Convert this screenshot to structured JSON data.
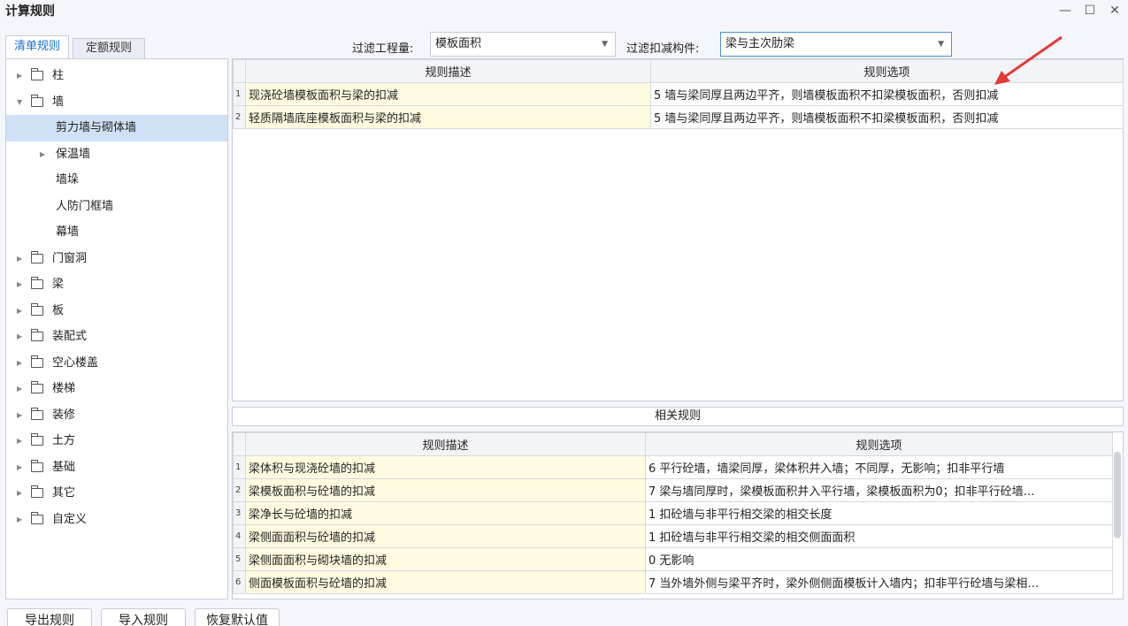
{
  "window": {
    "title": "计算规则",
    "min_glyph": "—",
    "max_glyph": "☐",
    "close_glyph": "✕"
  },
  "tabs": [
    {
      "label": "清单规则",
      "active": true
    },
    {
      "label": "定额规则",
      "active": false
    }
  ],
  "filters": {
    "quantity_label": "过滤工程量:",
    "quantity_value": "模板面积",
    "component_label": "过滤扣减构件:",
    "component_value": "梁与主次肋梁"
  },
  "tree": [
    {
      "label": "柱",
      "level": 0,
      "folder": true,
      "expanded": false
    },
    {
      "label": "墙",
      "level": 0,
      "folder": true,
      "expanded": true
    },
    {
      "label": "剪力墙与砌体墙",
      "level": 1,
      "folder": false,
      "selected": true
    },
    {
      "label": "保温墙",
      "level": 1,
      "folder": false,
      "has_children": true
    },
    {
      "label": "墙垛",
      "level": 1,
      "folder": false
    },
    {
      "label": "人防门框墙",
      "level": 1,
      "folder": false
    },
    {
      "label": "幕墙",
      "level": 1,
      "folder": false
    },
    {
      "label": "门窗洞",
      "level": 0,
      "folder": true
    },
    {
      "label": "梁",
      "level": 0,
      "folder": true
    },
    {
      "label": "板",
      "level": 0,
      "folder": true
    },
    {
      "label": "装配式",
      "level": 0,
      "folder": true
    },
    {
      "label": "空心楼盖",
      "level": 0,
      "folder": true
    },
    {
      "label": "楼梯",
      "level": 0,
      "folder": true
    },
    {
      "label": "装修",
      "level": 0,
      "folder": true
    },
    {
      "label": "土方",
      "level": 0,
      "folder": true
    },
    {
      "label": "基础",
      "level": 0,
      "folder": true
    },
    {
      "label": "其它",
      "level": 0,
      "folder": true
    },
    {
      "label": "自定义",
      "level": 0,
      "folder": true
    }
  ],
  "main_table": {
    "headers": [
      "规则描述",
      "规则选项"
    ],
    "rows": [
      {
        "num": "1",
        "desc": "现浇砼墙模板面积与梁的扣减",
        "option": "5  墙与梁同厚且两边平齐，则墙模板面积不扣梁模板面积，否则扣减"
      },
      {
        "num": "2",
        "desc": "轻质隔墙底座模板面积与梁的扣减",
        "option": "5  墙与梁同厚且两边平齐，则墙模板面积不扣梁模板面积，否则扣减"
      }
    ]
  },
  "related": {
    "title": "相关规则",
    "headers": [
      "规则描述",
      "规则选项"
    ],
    "rows": [
      {
        "num": "1",
        "desc": "梁体积与现浇砼墙的扣减",
        "option": "6 平行砼墙，墙梁同厚，梁体积并入墙；不同厚，无影响；扣非平行墙"
      },
      {
        "num": "2",
        "desc": "梁模板面积与砼墙的扣减",
        "option": "7 梁与墙同厚时，梁模板面积并入平行墙，梁模板面积为0；扣非平行砼墙…"
      },
      {
        "num": "3",
        "desc": "梁净长与砼墙的扣减",
        "option": "1 扣砼墙与非平行相交梁的相交长度"
      },
      {
        "num": "4",
        "desc": "梁侧面面积与砼墙的扣减",
        "option": "1 扣砼墙与非平行相交梁的相交侧面面积"
      },
      {
        "num": "5",
        "desc": "梁侧面面积与砌块墙的扣减",
        "option": "0  无影响"
      },
      {
        "num": "6",
        "desc": "侧面模板面积与砼墙的扣减",
        "option": "7 当外墙外侧与梁平齐时，梁外侧侧面模板计入墙内；扣非平行砼墙与梁相…"
      }
    ]
  },
  "buttons": {
    "export": "导出规则",
    "import": "导入规则",
    "restore": "恢复默认值"
  },
  "annotation": {
    "arrow_color": "#e53935"
  }
}
